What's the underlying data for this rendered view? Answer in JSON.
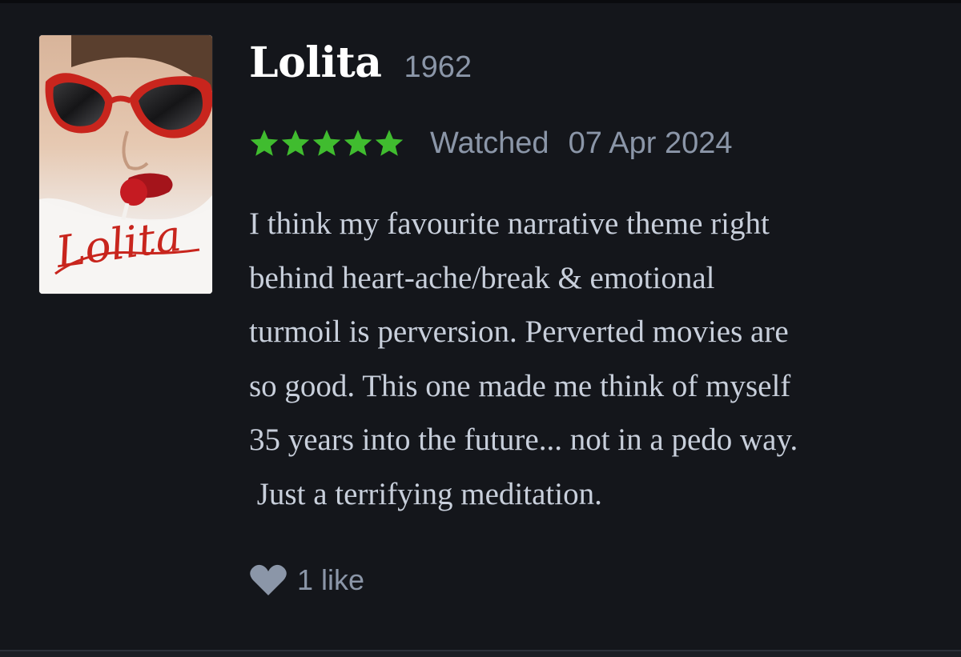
{
  "film": {
    "title": "Lolita",
    "year": "1962",
    "poster": {
      "icon": "film-poster-image",
      "logo_text": "Lolita"
    }
  },
  "rating": {
    "stars": 5,
    "max_stars": 5,
    "star_color": "#40bc2f"
  },
  "watched": {
    "label": "Watched",
    "date": "07 Apr 2024"
  },
  "review": {
    "lines": [
      "I think my favourite narrative theme right",
      "behind heart-ache/break & emotional",
      "turmoil is perversion. Perverted movies are",
      "so good. This one made me think of myself",
      "35 years into the future... not in a pedo way.",
      " Just a terrifying meditation."
    ]
  },
  "likes": {
    "icon": "heart-icon",
    "text": "1 like"
  },
  "colors": {
    "background": "#14161b",
    "title": "#ffffff",
    "muted": "#8b96a8",
    "body": "#c8cfdb"
  }
}
